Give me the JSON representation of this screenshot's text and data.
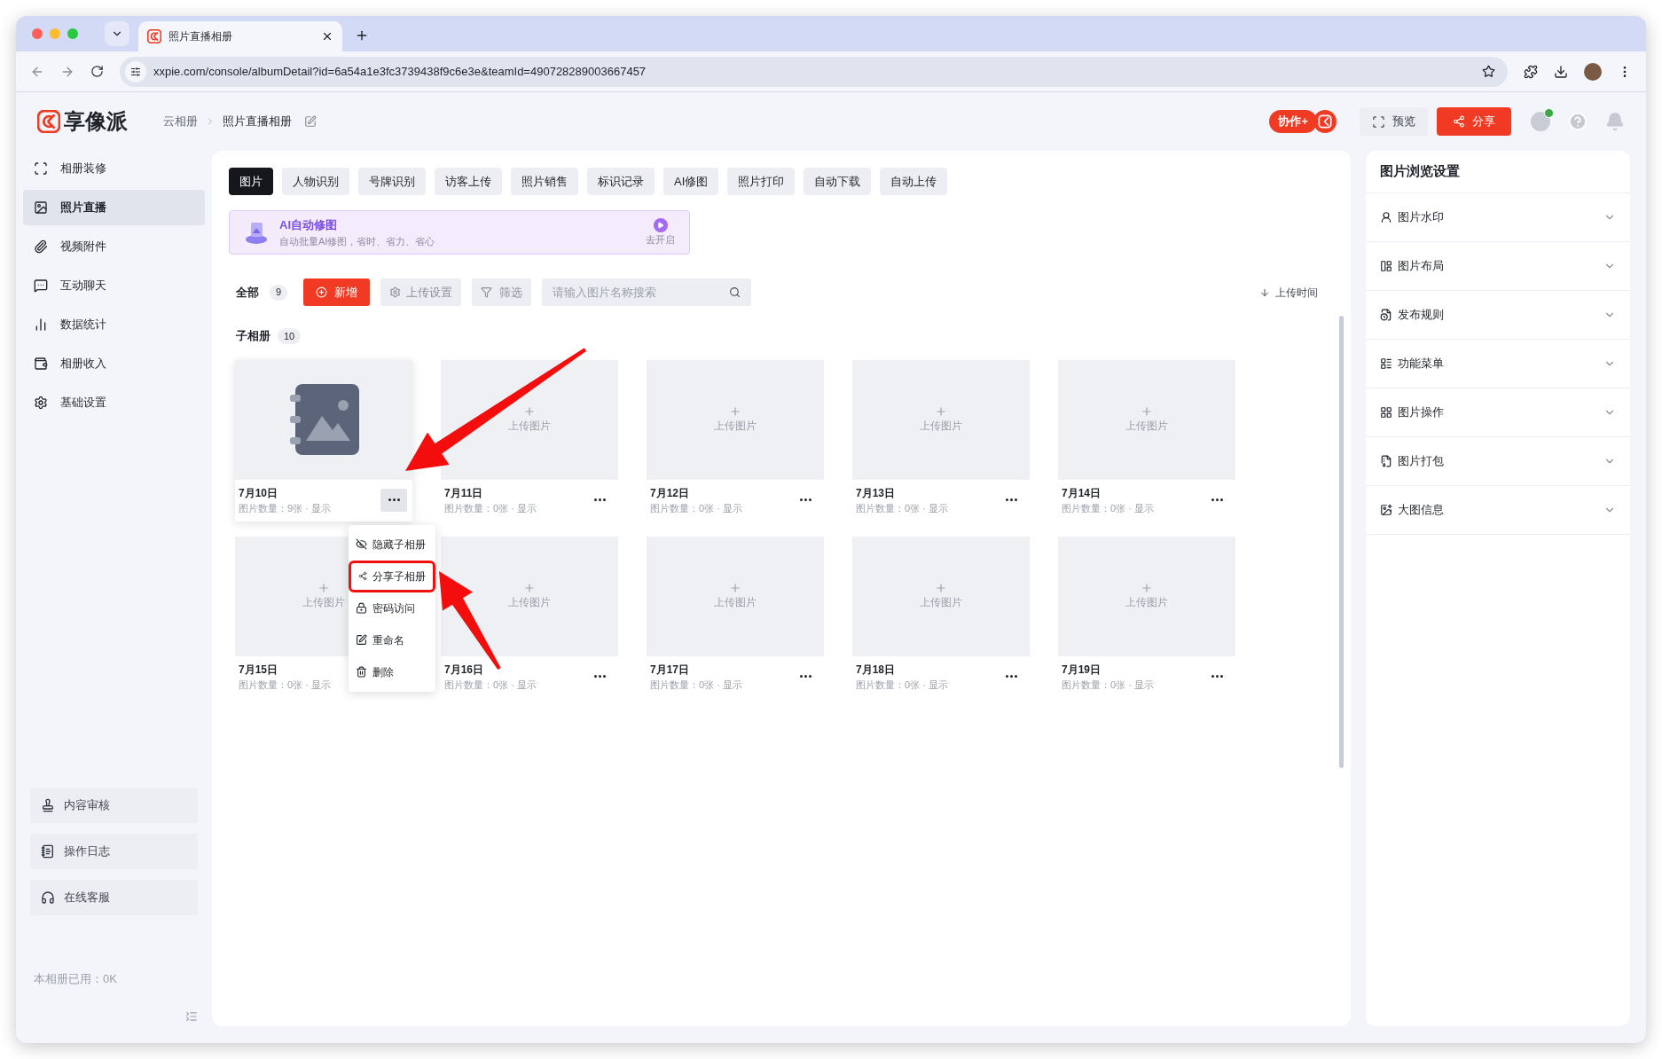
{
  "browser": {
    "tab_title": "照片直播相册",
    "url": "xxpie.com/console/albumDetail?id=6a54a1e3fc3739438f9c6e3e&teamId=490728289003667457"
  },
  "header": {
    "logo": "享像派",
    "breadcrumb": [
      "云相册",
      "照片直播相册"
    ],
    "collab": "协作+",
    "preview": "预览",
    "share": "分享"
  },
  "sidebar": {
    "items": [
      {
        "label": "相册装修",
        "selected": false
      },
      {
        "label": "照片直播",
        "selected": true
      },
      {
        "label": "视频附件",
        "selected": false
      },
      {
        "label": "互动聊天",
        "selected": false
      },
      {
        "label": "数据统计",
        "selected": false
      },
      {
        "label": "相册收入",
        "selected": false
      },
      {
        "label": "基础设置",
        "selected": false
      }
    ],
    "footer_buttons": [
      "内容审核",
      "操作日志",
      "在线客服"
    ],
    "usage": "本相册已用：0K"
  },
  "tabs": [
    {
      "label": "图片",
      "selected": true
    },
    {
      "label": "人物识别",
      "selected": false
    },
    {
      "label": "号牌识别",
      "selected": false
    },
    {
      "label": "访客上传",
      "selected": false
    },
    {
      "label": "照片销售",
      "selected": false
    },
    {
      "label": "标识记录",
      "selected": false
    },
    {
      "label": "AI修图",
      "selected": false
    },
    {
      "label": "照片打印",
      "selected": false
    },
    {
      "label": "自动下载",
      "selected": false
    },
    {
      "label": "自动上传",
      "selected": false
    }
  ],
  "ai_banner": {
    "title": "AI自动修图",
    "subtitle": "自动批量AI修图，省时、省力、省心",
    "action": "去开启"
  },
  "toolbar": {
    "all_label": "全部",
    "all_count": "9",
    "add": "新增",
    "upload_settings": "上传设置",
    "filter": "筛选",
    "search": {
      "placeholder": "请输入图片名称搜索"
    },
    "sort": "上传时间"
  },
  "sub_albums": {
    "label": "子相册",
    "count": "10",
    "albums": [
      {
        "kind": "cover",
        "title": "7月10日",
        "info": "图片数量：9张 · 显示",
        "hovered": true,
        "more_button": true
      },
      {
        "kind": "empty",
        "upload_label": "上传图片",
        "title": "7月11日",
        "info": "图片数量：0张 · 显示",
        "hovered": false,
        "more_button": true
      },
      {
        "kind": "empty",
        "upload_label": "上传图片",
        "title": "7月12日",
        "info": "图片数量：0张 · 显示",
        "hovered": false,
        "more_button": true
      },
      {
        "kind": "empty",
        "upload_label": "上传图片",
        "title": "7月13日",
        "info": "图片数量：0张 · 显示",
        "hovered": false,
        "more_button": true
      },
      {
        "kind": "empty",
        "upload_label": "上传图片",
        "title": "7月14日",
        "info": "图片数量：0张 · 显示",
        "hovered": false,
        "more_button": true
      },
      {
        "kind": "empty",
        "upload_label": "上传图片",
        "title": "7月15日",
        "info": "图片数量：0张 · 显示",
        "hovered": false,
        "more_button": false
      },
      {
        "kind": "empty",
        "upload_label": "上传图片",
        "title": "7月16日",
        "info": "图片数量：0张 · 显示",
        "hovered": false,
        "more_button": true
      },
      {
        "kind": "empty",
        "upload_label": "上传图片",
        "title": "7月17日",
        "info": "图片数量：0张 · 显示",
        "hovered": false,
        "more_button": true
      },
      {
        "kind": "empty",
        "upload_label": "上传图片",
        "title": "7月18日",
        "info": "图片数量：0张 · 显示",
        "hovered": false,
        "more_button": true
      },
      {
        "kind": "empty",
        "upload_label": "上传图片",
        "title": "7月19日",
        "info": "图片数量：0张 · 显示",
        "hovered": false,
        "more_button": true
      }
    ],
    "menu": {
      "items": [
        {
          "label": "隐藏子相册",
          "highlighted": false
        },
        {
          "label": "分享子相册",
          "highlighted": true
        },
        {
          "label": "密码访问",
          "highlighted": false
        },
        {
          "label": "重命名",
          "highlighted": false
        },
        {
          "label": "删除",
          "highlighted": false
        }
      ]
    }
  },
  "settings_panel": {
    "title": "图片浏览设置",
    "sections": [
      {
        "label": "图片水印",
        "expanded": false
      },
      {
        "label": "图片布局",
        "expanded": false
      },
      {
        "label": "发布规则",
        "expanded": false
      },
      {
        "label": "功能菜单",
        "expanded": false
      },
      {
        "label": "图片操作",
        "expanded": false
      },
      {
        "label": "图片打包",
        "expanded": false
      },
      {
        "label": "大图信息",
        "expanded": false
      }
    ]
  }
}
